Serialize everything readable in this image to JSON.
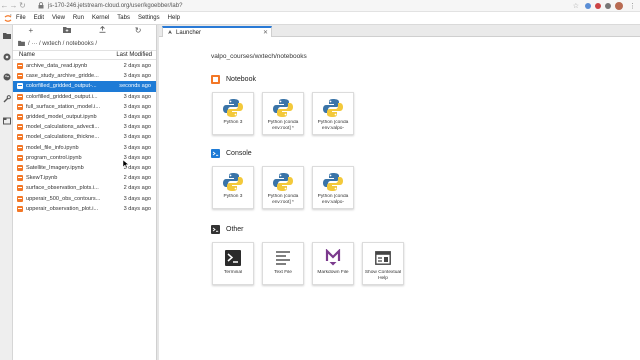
{
  "browser": {
    "url": "js-170-246.jetstream-cloud.org/user/kgoebber/lab?"
  },
  "menubar": {
    "items": [
      "File",
      "Edit",
      "View",
      "Run",
      "Kernel",
      "Tabs",
      "Settings",
      "Help"
    ]
  },
  "filebrowser": {
    "breadcrumb": "/ ··· / wxtech / notebooks /",
    "header_name": "Name",
    "header_modified": "Last Modified",
    "files": [
      {
        "name": "archive_data_read.ipynb",
        "modified": "2 days ago"
      },
      {
        "name": "case_study_archive_gridde...",
        "modified": "3 days ago"
      },
      {
        "name": "colorfilled_gridded_output-...",
        "modified": "seconds ago"
      },
      {
        "name": "colorfilled_gridded_output.i...",
        "modified": "3 days ago"
      },
      {
        "name": "full_surface_station_model.i...",
        "modified": "3 days ago"
      },
      {
        "name": "gridded_model_output.ipynb",
        "modified": "3 days ago"
      },
      {
        "name": "model_calculations_advecti...",
        "modified": "3 days ago"
      },
      {
        "name": "model_calculations_thickne...",
        "modified": "3 days ago"
      },
      {
        "name": "model_file_info.ipynb",
        "modified": "3 days ago"
      },
      {
        "name": "program_control.ipynb",
        "modified": "3 days ago"
      },
      {
        "name": "Satellite_Imagery.ipynb",
        "modified": "3 days ago"
      },
      {
        "name": "SkewT.ipynb",
        "modified": "2 days ago"
      },
      {
        "name": "surface_observation_plots.i...",
        "modified": "2 days ago"
      },
      {
        "name": "upperair_500_obs_contours...",
        "modified": "3 days ago"
      },
      {
        "name": "upperair_observation_plot.i...",
        "modified": "3 days ago"
      }
    ],
    "selected_index": 2
  },
  "tab": {
    "label": "Launcher"
  },
  "launcher": {
    "path": "valpo_courses/wxtech/notebooks",
    "sections": [
      {
        "title": "Notebook",
        "icon": "notebook-section-icon",
        "items": [
          {
            "label": "Python 3",
            "icon": "python-logo-icon"
          },
          {
            "label": "Python [conda env:root] *",
            "icon": "python-logo-icon"
          },
          {
            "label": "Python [conda env:valpo-",
            "icon": "python-logo-icon"
          }
        ]
      },
      {
        "title": "Console",
        "icon": "console-section-icon",
        "items": [
          {
            "label": "Python 3",
            "icon": "python-logo-icon"
          },
          {
            "label": "Python [conda env:root] *",
            "icon": "python-logo-icon"
          },
          {
            "label": "Python [conda env:valpo-",
            "icon": "python-logo-icon"
          }
        ]
      },
      {
        "title": "Other",
        "icon": "other-section-icon",
        "items": [
          {
            "label": "Terminal",
            "icon": "terminal-icon"
          },
          {
            "label": "Text File",
            "icon": "text-file-icon"
          },
          {
            "label": "Markdown File",
            "icon": "markdown-icon"
          },
          {
            "label": "Show Contextual Help",
            "icon": "contextual-help-icon"
          }
        ]
      }
    ]
  },
  "colors": {
    "accent": "#1e7bd6",
    "jupyter_orange": "#f37726",
    "markdown_purple": "#7b3a8d",
    "python_blue": "#3a74a8",
    "python_yellow": "#f3c93b"
  }
}
